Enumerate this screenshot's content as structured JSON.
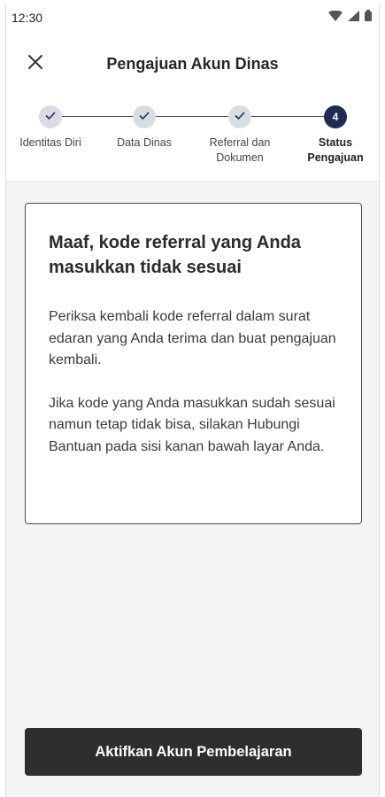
{
  "status_bar": {
    "time": "12:30",
    "icons": [
      "wifi-icon",
      "signal-icon",
      "battery-icon"
    ]
  },
  "header": {
    "title": "Pengajuan Akun Dinas",
    "close_icon": "close-icon"
  },
  "stepper": {
    "steps": [
      {
        "label": "Identitas Diri",
        "state": "done"
      },
      {
        "label": "Data Dinas",
        "state": "done"
      },
      {
        "label": "Referral dan Dokumen",
        "state": "done"
      },
      {
        "label": "Status Pengajuan",
        "state": "active",
        "number": "4"
      }
    ]
  },
  "message": {
    "title": "Maaf, kode referral yang Anda masukkan tidak sesuai",
    "paragraph_1": "Periksa kembali kode referral dalam surat edaran yang Anda terima dan buat pengajuan kembali.",
    "paragraph_2": "Jika kode yang Anda masukkan sudah sesuai namun tetap tidak bisa, silakan Hubungi Bantuan pada sisi kanan bawah layar Anda."
  },
  "footer": {
    "button_label": "Aktifkan Akun Pembelajaran"
  },
  "colors": {
    "active_step": "#1b2d54",
    "done_step": "#d9dde3",
    "button": "#2e2e2e",
    "background": "#f4f4f4"
  }
}
